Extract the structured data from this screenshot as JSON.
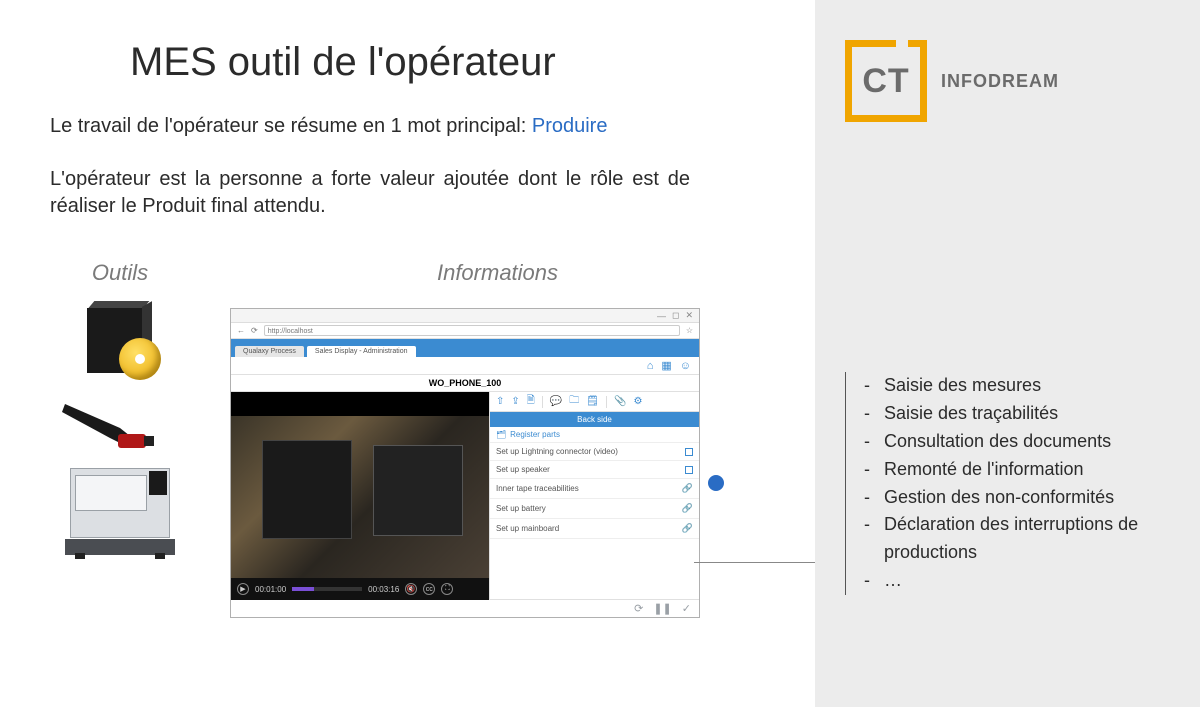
{
  "title": "MES outil de l'opérateur",
  "intro_line1_prefix": "Le travail de l'opérateur se résume en 1 mot principal: ",
  "intro_line1_highlight": "Produire",
  "intro_line2": "L'opérateur est la personne a forte valeur ajoutée dont le rôle est de réaliser le Produit final attendu.",
  "columns": {
    "outils_title": "Outils",
    "informations_title": "Informations"
  },
  "browser": {
    "url_prefix": "http://localhost",
    "tab1": "Qualaxy Process",
    "tab2": "Sales Display - Administration",
    "doc_title": "WO_PHONE_100",
    "panel_header": "Back side",
    "panel_sub": "Register parts",
    "rows": [
      "Set up Lightning connector (video)",
      "Set up speaker",
      "Inner tape traceabilities",
      "Set up battery",
      "Set up mainboard"
    ],
    "time_current": "00:01:00",
    "time_total": "00:03:16"
  },
  "logo": {
    "short": "CT",
    "name": "INFODREAM"
  },
  "bullets": [
    "Saisie des mesures",
    "Saisie des traçabilités",
    "Consultation des documents",
    "Remonté de l'information",
    "Gestion des non-conformités",
    "Déclaration des interruptions de productions",
    "…"
  ]
}
